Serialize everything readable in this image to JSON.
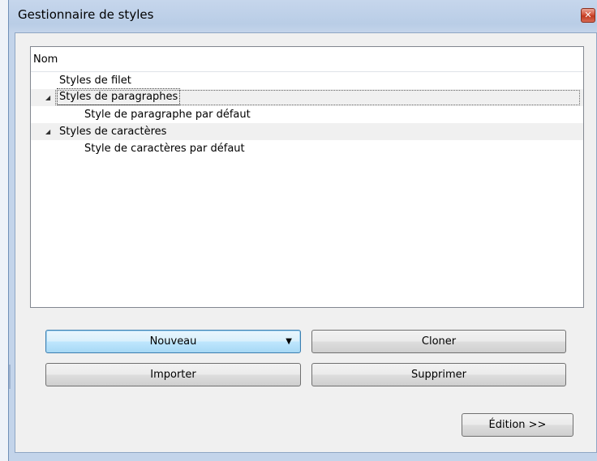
{
  "window": {
    "title": "Gestionnaire de styles",
    "close_glyph": "✕"
  },
  "tree": {
    "column_header": "Nom",
    "rows": [
      {
        "label": "Styles de filet",
        "level": 1,
        "expander": ""
      },
      {
        "label": "Styles de paragraphes",
        "level": 1,
        "expander": "◢"
      },
      {
        "label": "Style de paragraphe par défaut",
        "level": 2,
        "expander": ""
      },
      {
        "label": "Styles de caractères",
        "level": 1,
        "expander": "◢"
      },
      {
        "label": "Style de caractères par défaut",
        "level": 2,
        "expander": ""
      }
    ]
  },
  "buttons": {
    "new": "Nouveau",
    "new_arrow": "▼",
    "clone": "Cloner",
    "import": "Importer",
    "delete": "Supprimer",
    "edit": "Édition >>"
  }
}
